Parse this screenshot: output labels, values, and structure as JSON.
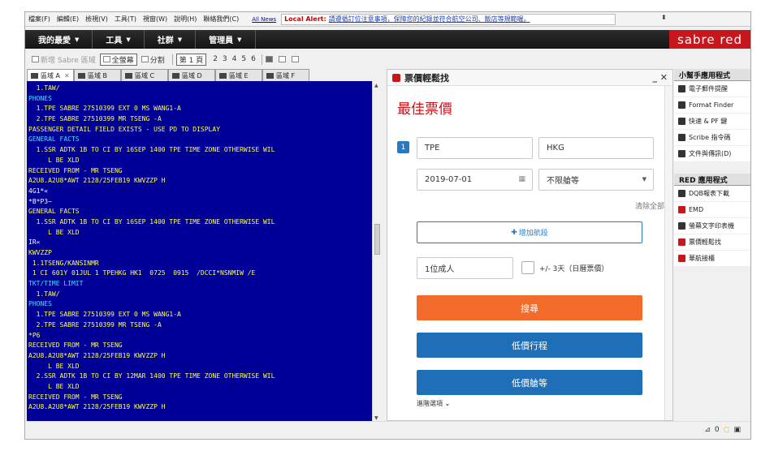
{
  "menu": [
    "檔案(F)",
    "編輯(E)",
    "檢視(V)",
    "工具(T)",
    "視窗(W)",
    "說明(H)",
    "聯絡我們(C)"
  ],
  "all_news": "All News",
  "alert": {
    "label": "Local Alert:",
    "text": "請遵循訂位注意事項，保障您的紀錄並符合航空公司、飯店等規範喔。"
  },
  "nav": {
    "items": [
      "我的最愛",
      "工具",
      "社群",
      "管理員"
    ],
    "brand": "sabre red"
  },
  "toolbar": {
    "new_area": "新增 Sabre 區域",
    "full": "全螢幕",
    "split": "分割",
    "page_label": "第 1 頁",
    "pages": [
      "2",
      "3",
      "4",
      "5",
      "6"
    ]
  },
  "tabs": [
    "區域 A",
    "區域 B",
    "區域 C",
    "區域 D",
    "區域 E",
    "區域 F"
  ],
  "terminal": [
    {
      "t": "  1.TAW/",
      "c": "y"
    },
    {
      "t": "PHONES",
      "c": "c"
    },
    {
      "t": "  1.TPE SABRE 27510399 EXT 0 MS WANG1-A",
      "c": "y"
    },
    {
      "t": "  2.TPE SABRE 27510399 MR TSENG -A",
      "c": "y"
    },
    {
      "t": "PASSENGER DETAIL FIELD EXISTS - USE PD TO DISPLAY",
      "c": "y"
    },
    {
      "t": "GENERAL FACTS",
      "c": "c"
    },
    {
      "t": "  1.SSR ADTK 1B TO CI BY 16SEP 1400 TPE TIME ZONE OTHERWISE WIL",
      "c": "y"
    },
    {
      "t": "     L BE XLD",
      "c": "y"
    },
    {
      "t": "RECEIVED FROM - MR TSENG",
      "c": "y"
    },
    {
      "t": "A2U8.A2U8*AWT 2128/25FEB19 KWVZZP H",
      "c": "y"
    },
    {
      "t": "4G1*«",
      "c": "w"
    },
    {
      "t": "*B*P3~",
      "c": "w"
    },
    {
      "t": "GENERAL FACTS",
      "c": "y"
    },
    {
      "t": "  1.SSR ADTK 1B TO CI BY 16SEP 1400 TPE TIME ZONE OTHERWISE WIL",
      "c": "y"
    },
    {
      "t": "     L BE XLD",
      "c": "y"
    },
    {
      "t": "IR«",
      "c": "w"
    },
    {
      "t": "KWVZZP",
      "c": "y"
    },
    {
      "t": " 1.1TSENG/KANSINMR",
      "c": "y"
    },
    {
      "t": " 1 CI 601Y 01JUL 1 TPEHKG HK1  0725  0915  /DCCI*NSNMIW /E",
      "c": "y"
    },
    {
      "t": "TKT/TIME LIMIT",
      "c": "c"
    },
    {
      "t": "  1.TAW/",
      "c": "y"
    },
    {
      "t": "PHONES",
      "c": "c"
    },
    {
      "t": "  1.TPE SABRE 27510399 EXT 0 MS WANG1-A",
      "c": "y"
    },
    {
      "t": "  2.TPE SABRE 27510399 MR TSENG -A",
      "c": "y"
    },
    {
      "t": "*P6",
      "c": "y"
    },
    {
      "t": "RECEIVED FROM - MR TSENG",
      "c": "y"
    },
    {
      "t": "A2U8.A2U8*AWT 2128/25FEB19 KWVZZP H",
      "c": "y"
    },
    {
      "t": "     L BE XLD",
      "c": "y"
    },
    {
      "t": "  2.SSR ADTK 1B TO CI BY 12MAR 1400 TPE TIME ZONE OTHERWISE WIL",
      "c": "y"
    },
    {
      "t": "     L BE XLD",
      "c": "y"
    },
    {
      "t": "RECEIVED FROM - MR TSENG",
      "c": "y"
    },
    {
      "t": "A2U8.A2U8*AWT 2128/25FEB19 KWVZZP H",
      "c": "y"
    }
  ],
  "fare": {
    "title": "票價輕鬆找",
    "heading": "最佳票價",
    "leg_number": "1",
    "origin": "TPE",
    "destination": "HKG",
    "date": "2019-07-01",
    "cabin": "不限艙等",
    "clear_all": "清除全部",
    "add_leg": "增加航段",
    "passengers": "1位成人",
    "flex_label": "+/- 3天（日曆票價）",
    "search": "搜尋",
    "low_itin": "低價行程",
    "low_cabin": "低價艙等",
    "advanced": "進階選項",
    "colors": {
      "search": "#f26b2b",
      "blue": "#1f6fb8",
      "brand": "#c8161d"
    }
  },
  "sidebar": {
    "helper_title": "小幫手應用程式",
    "helper_items": [
      "電子郵件提醒",
      "Format Finder",
      "快速 & PF 鍵",
      "Scribe 指令碼",
      "文件與傳訊(D)"
    ],
    "red_title": "RED 應用程式",
    "red_items": [
      "DQB報表下載",
      "EMD",
      "螢幕文字印表機",
      "票價輕鬆找",
      "華航接櫃"
    ]
  },
  "status": {
    "count": "0"
  }
}
